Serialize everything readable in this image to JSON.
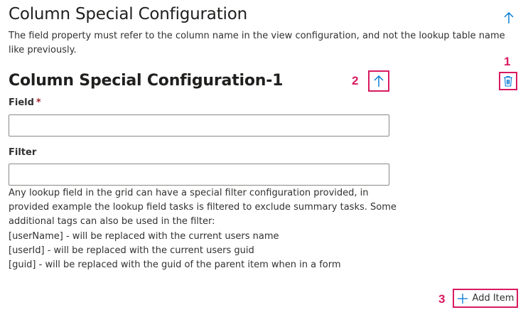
{
  "section": {
    "title": "Column Special Configuration",
    "description": "The field property must refer to the column name in the view configuration, and not the lookup table name like previously."
  },
  "item": {
    "title": "Column Special Configuration-1",
    "field_label": "Field",
    "required_marker": "*",
    "field_value": "",
    "filter_label": "Filter",
    "filter_value": "",
    "help_lines": [
      "Any lookup field in the grid can have a special filter configuration provided, in",
      "provided example the lookup field tasks is filtered to exclude summary tasks. Some",
      "additional tags can also be used in the filter:",
      "[userName] - will be replaced with the current users name",
      "[userId] - will be replaced with the current users guid",
      "[guid] - will be replaced with the guid of the parent item when in a form"
    ]
  },
  "annotations": {
    "n1": "1",
    "n2": "2",
    "n3": "3"
  },
  "add_button": {
    "label": "Add Item"
  },
  "icons": {
    "move_up_section": "arrow-up-icon",
    "move_up_item": "arrow-up-icon",
    "delete": "trash-icon",
    "add": "plus-icon"
  },
  "colors": {
    "accent": "#0078d4",
    "annotation": "#d81b60",
    "required": "#a4262c"
  }
}
